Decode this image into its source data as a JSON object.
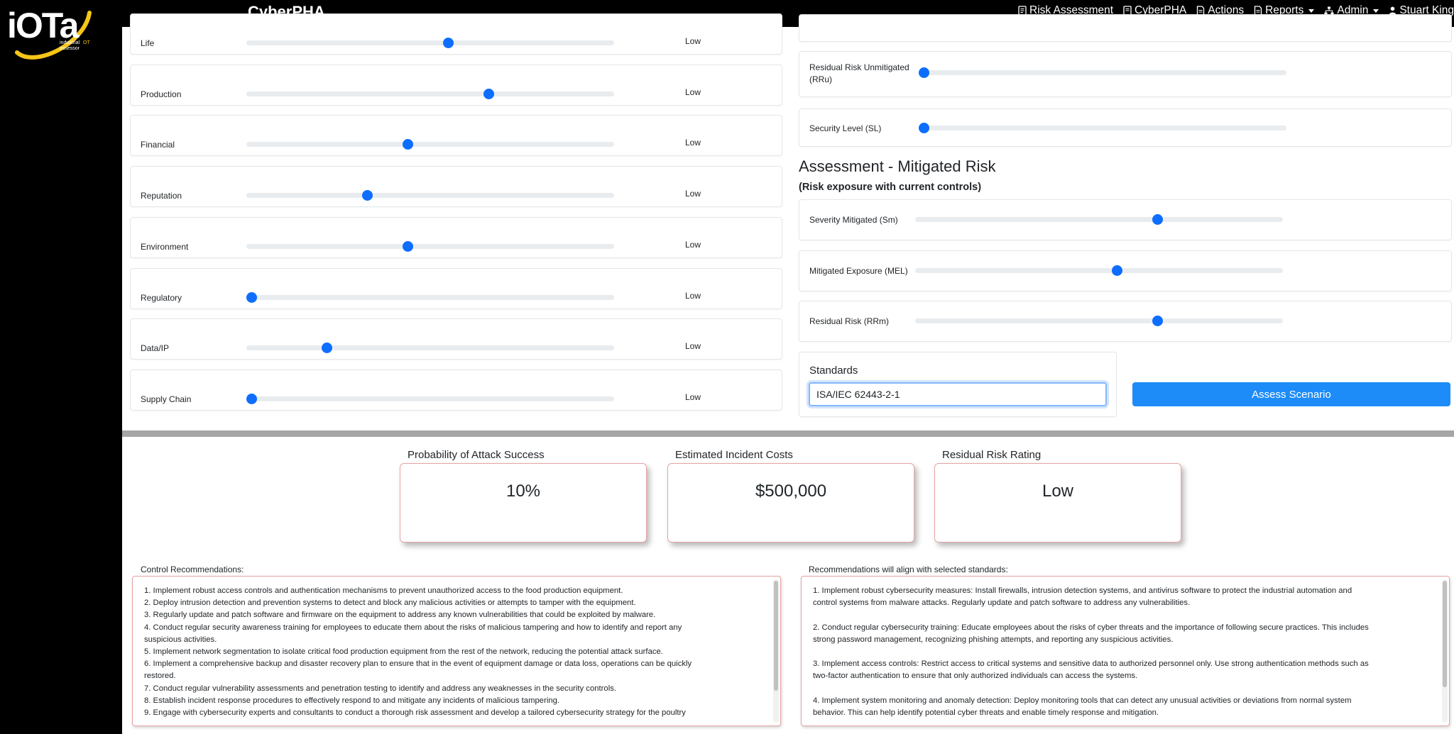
{
  "app": {
    "title": "CyberPHA",
    "logo_text": "iOTa",
    "logo_subtext": "industrial OT assessor"
  },
  "nav": {
    "risk_assessment": "Risk Assessment",
    "cyberpha": "CyberPHA",
    "actions": "Actions",
    "reports": "Reports",
    "admin": "Admin",
    "user": "Stuart King"
  },
  "impacts": [
    {
      "label": "Life",
      "value": "Low",
      "level": 0.55
    },
    {
      "label": "Production",
      "value": "Low",
      "level": 0.66
    },
    {
      "label": "Financial",
      "value": "Low",
      "level": 0.44
    },
    {
      "label": "Reputation",
      "value": "Low",
      "level": 0.33
    },
    {
      "label": "Environment",
      "value": "Low",
      "level": 0.44
    },
    {
      "label": "Regulatory",
      "value": "Low",
      "level": 0.0
    },
    {
      "label": "Data/IP",
      "value": "Low",
      "level": 0.22
    },
    {
      "label": "Supply Chain",
      "value": "Low",
      "level": 0.0
    }
  ],
  "unmitigated": [
    {
      "label": "Residual Risk Unmitigated (RRu)",
      "level": 0.0
    },
    {
      "label": "Security Level (SL)",
      "level": 0.0
    }
  ],
  "mitigated_section": {
    "title": "Assessment - Mitigated Risk",
    "subtitle": "(Risk exposure with current controls)",
    "rows": [
      {
        "label": "Severity Mitigated (Sm)",
        "level": 0.66
      },
      {
        "label": "Mitigated Exposure (MEL)",
        "level": 0.55
      },
      {
        "label": "Residual Risk (RRm)",
        "level": 0.66
      }
    ]
  },
  "standards": {
    "label": "Standards",
    "value": "ISA/IEC 62443-2-1"
  },
  "assess_button": "Assess Scenario",
  "metrics": {
    "probability": {
      "label": "Probability of Attack Success",
      "value": "10%"
    },
    "costs": {
      "label": "Estimated Incident Costs",
      "value": "$500,000"
    },
    "rating": {
      "label": "Residual Risk Rating",
      "value": "Low"
    }
  },
  "control_recommendations": {
    "title": "Control Recommendations:",
    "text": "1. Implement robust access controls and authentication mechanisms to prevent unauthorized access to the food production equipment.\n2. Deploy intrusion detection and prevention systems to detect and block any malicious activities or attempts to tamper with the equipment.\n3. Regularly update and patch software and firmware on the equipment to address any known vulnerabilities that could be exploited by malware.\n4. Conduct regular security awareness training for employees to educate them about the risks of malicious tampering and how to identify and report any\nsuspicious activities.\n5. Implement network segmentation to isolate critical food production equipment from the rest of the network, reducing the potential attack surface.\n6. Implement a comprehensive backup and disaster recovery plan to ensure that in the event of equipment damage or data loss, operations can be quickly\nrestored.\n7. Conduct regular vulnerability assessments and penetration testing to identify and address any weaknesses in the security controls.\n8. Establish incident response procedures to effectively respond to and mitigate any incidents of malicious tampering.\n9. Engage with cybersecurity experts and consultants to conduct a thorough risk assessment and develop a tailored cybersecurity strategy for the poultry"
  },
  "standards_recommendations": {
    "title": "Recommendations will align with selected standards:",
    "text": "1. Implement robust cybersecurity measures: Install firewalls, intrusion detection systems, and antivirus software to protect the industrial automation and\ncontrol systems from malware attacks. Regularly update and patch software to address any vulnerabilities.\n\n2. Conduct regular cybersecurity training: Educate employees about the risks of cyber threats and the importance of following secure practices. This includes\nstrong password management, recognizing phishing attempts, and reporting any suspicious activities.\n\n3. Implement access controls: Restrict access to critical systems and sensitive data to authorized personnel only. Use strong authentication methods such as\ntwo-factor authentication to ensure that only authorized individuals can access the systems.\n\n4. Implement system monitoring and anomaly detection: Deploy monitoring tools that can detect any unusual activities or deviations from normal system\nbehavior. This can help identify potential cyber threats and enable timely response and mitigation."
  },
  "colors": {
    "accent": "#0d6efd",
    "button": "#1d8cf8",
    "card_border": "#e8a3a3",
    "logo_yellow": "#f5c518"
  }
}
